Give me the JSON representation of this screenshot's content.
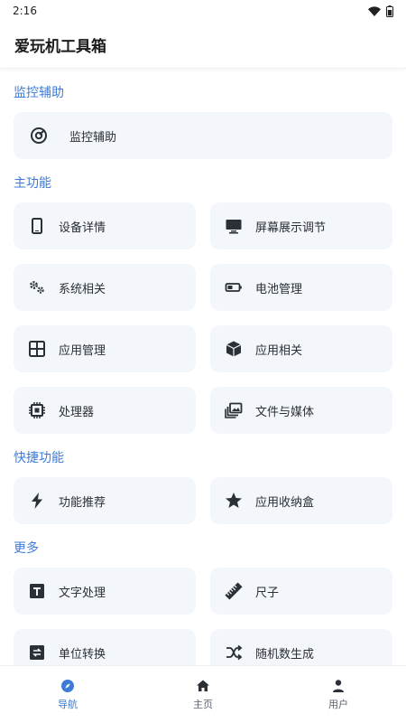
{
  "status_bar": {
    "time": "2:16"
  },
  "app_bar": {
    "title": "爱玩机工具箱"
  },
  "sections": {
    "monitor": {
      "title": "监控辅助",
      "item": "监控辅助"
    },
    "main": {
      "title": "主功能",
      "items": [
        "设备详情",
        "屏幕展示调节",
        "系统相关",
        "电池管理",
        "应用管理",
        "应用相关",
        "处理器",
        "文件与媒体"
      ]
    },
    "quick": {
      "title": "快捷功能",
      "items": [
        "功能推荐",
        "应用收纳盒"
      ]
    },
    "more": {
      "title": "更多",
      "items": [
        "文字处理",
        "尺子",
        "单位转换",
        "随机数生成"
      ]
    }
  },
  "bottom_nav": {
    "items": [
      "导航",
      "主页",
      "用户"
    ],
    "active_index": 0
  },
  "colors": {
    "accent": "#3e7bd6",
    "card_bg": "#f3f6fb",
    "icon": "#2b2f36"
  }
}
